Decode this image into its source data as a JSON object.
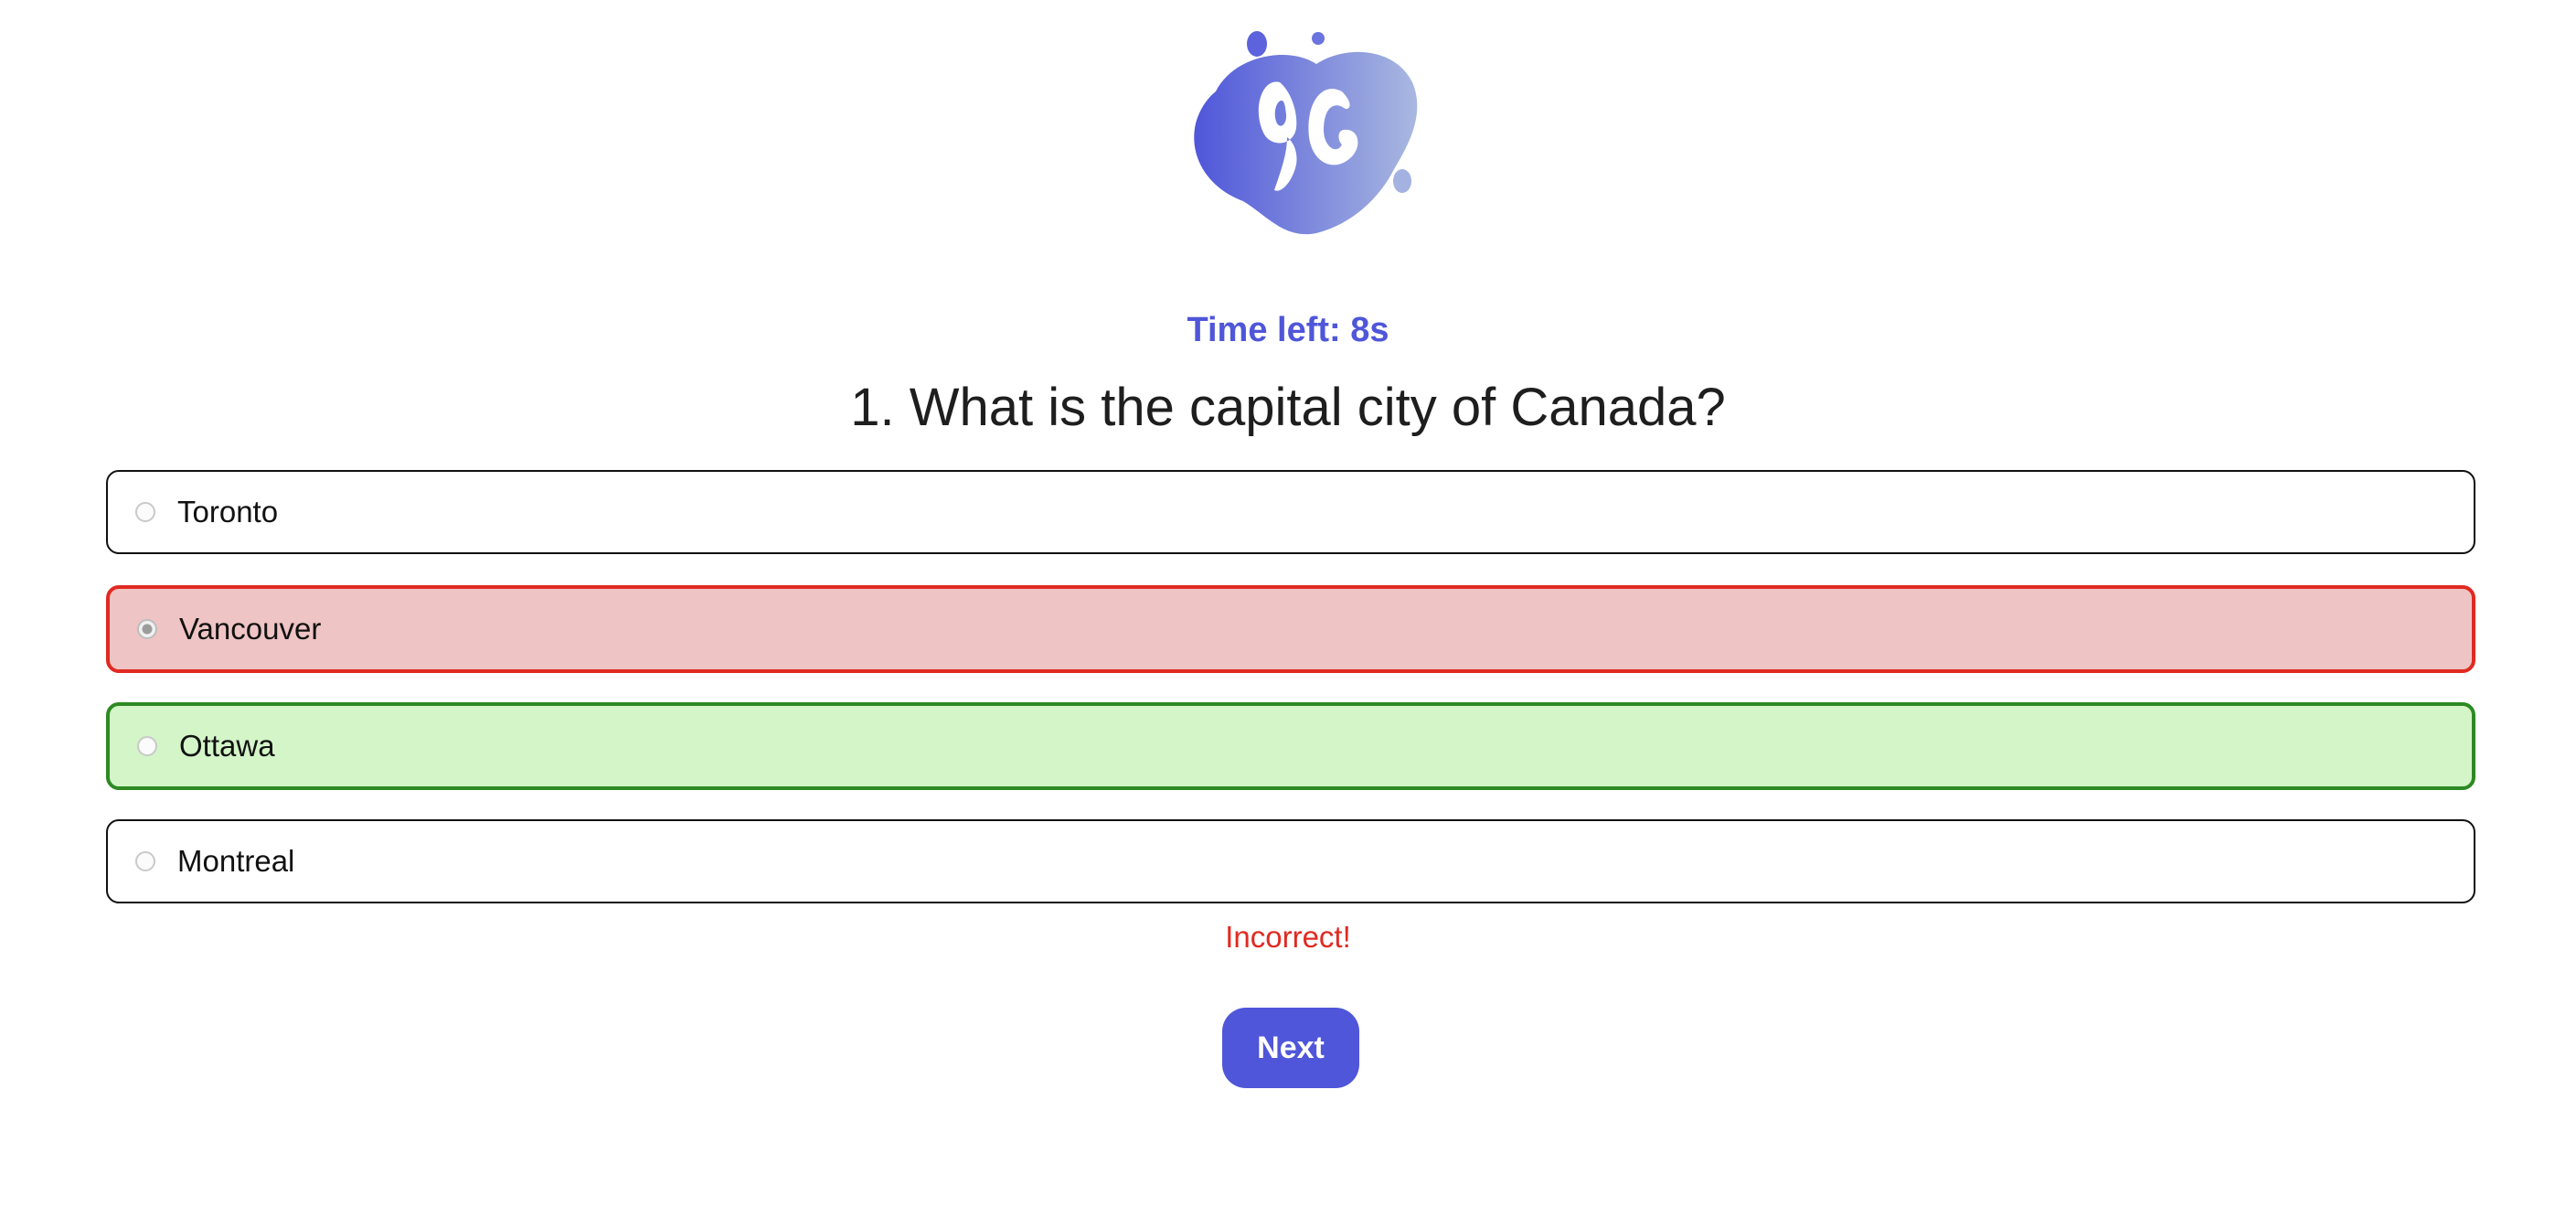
{
  "logo": {
    "icon": "blob-logo-icon",
    "text": "QG",
    "colors": {
      "start": "#4f56d9",
      "end": "#a9b8e0"
    }
  },
  "quiz": {
    "timer_text": "Time left: 8s",
    "question": "1. What is the capital city of Canada?",
    "options": [
      {
        "label": "Toronto",
        "state": "default"
      },
      {
        "label": "Vancouver",
        "state": "selected-incorrect"
      },
      {
        "label": "Ottawa",
        "state": "correct"
      },
      {
        "label": "Montreal",
        "state": "default"
      }
    ],
    "feedback": "Incorrect!",
    "next_label": "Next"
  },
  "colors": {
    "accent": "#4f56d9",
    "incorrect_border": "#e02a22",
    "incorrect_bg": "#efc4c4",
    "correct_border": "#2d8a22",
    "correct_bg": "#d3f5c8"
  }
}
